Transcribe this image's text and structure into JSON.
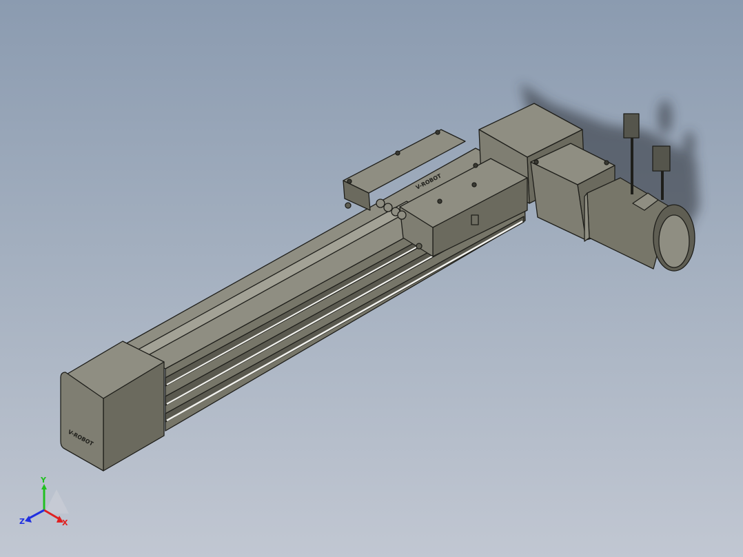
{
  "model": {
    "brand_engraving_front": "V-ROBOT",
    "brand_engraving_carriage": "V-ROBOT"
  },
  "triad": {
    "x_label": "X",
    "y_label": "Y",
    "z_label": "Z",
    "x_color": "#e02020",
    "y_color": "#20c020",
    "z_color": "#2030e0"
  },
  "colors": {
    "body_light": "#8f8e82",
    "body_mid": "#777669",
    "body_dark": "#5f5e53",
    "edge": "#1e1e1a",
    "slot_highlight": "#f2f2ee"
  }
}
